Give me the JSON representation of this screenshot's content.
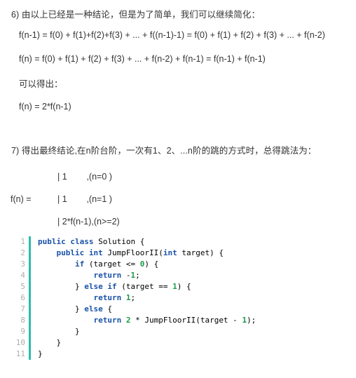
{
  "document": {
    "sections": [
      {
        "heading": "6) 由以上已经是一种结论，但是为了简单，我们可以继续简化：",
        "formulas": [
          "f(n-1) = f(0) + f(1)+f(2)+f(3) + ... + f((n-1)-1) = f(0) + f(1) + f(2) + f(3) + ... + f(n-2)",
          "f(n) = f(0) + f(1) + f(2) + f(3) + ... + f(n-2) + f(n-1) = f(n-1) + f(n-1)"
        ],
        "conclusion_label": "可以得出：",
        "conclusion_formula": "f(n) = 2*f(n-1)"
      },
      {
        "heading": "7) 得出最终结论,在n阶台阶，一次有1、2、...n阶的跳的方式时，总得跳法为：",
        "piecewise": {
          "lhs": "f(n) =",
          "rows": [
            "| 1        ,(n=0 )",
            "| 1        ,(n=1 )",
            "| 2*f(n-1),(n>=2)"
          ]
        }
      }
    ]
  },
  "code_block": {
    "language": "java",
    "gutter_accent_color": "#2bbbad",
    "keyword_color": "#1a52a8",
    "number_color": "#1a9a4a",
    "line_number_color": "#afafaf",
    "line_numbers": [
      "1",
      "2",
      "3",
      "4",
      "5",
      "6",
      "7",
      "8",
      "9",
      "10",
      "11"
    ],
    "lines": [
      [
        {
          "t": "kw",
          "s": "public"
        },
        {
          "t": "pn",
          "s": " "
        },
        {
          "t": "kw",
          "s": "class"
        },
        {
          "t": "pn",
          "s": " "
        },
        {
          "t": "id",
          "s": "Solution {"
        }
      ],
      [
        {
          "t": "pn",
          "s": "    "
        },
        {
          "t": "kw",
          "s": "public"
        },
        {
          "t": "pn",
          "s": " "
        },
        {
          "t": "kw",
          "s": "int"
        },
        {
          "t": "pn",
          "s": " "
        },
        {
          "t": "id",
          "s": "JumpFloorII("
        },
        {
          "t": "kw",
          "s": "int"
        },
        {
          "t": "id",
          "s": " target) {"
        }
      ],
      [
        {
          "t": "pn",
          "s": "        "
        },
        {
          "t": "kw",
          "s": "if"
        },
        {
          "t": "id",
          "s": " (target <= "
        },
        {
          "t": "num",
          "s": "0"
        },
        {
          "t": "id",
          "s": ") {"
        }
      ],
      [
        {
          "t": "pn",
          "s": "            "
        },
        {
          "t": "kw",
          "s": "return"
        },
        {
          "t": "id",
          "s": " -"
        },
        {
          "t": "num",
          "s": "1"
        },
        {
          "t": "id",
          "s": ";"
        }
      ],
      [
        {
          "t": "pn",
          "s": "        "
        },
        {
          "t": "id",
          "s": "} "
        },
        {
          "t": "kw",
          "s": "else"
        },
        {
          "t": "pn",
          "s": " "
        },
        {
          "t": "kw",
          "s": "if"
        },
        {
          "t": "id",
          "s": " (target == "
        },
        {
          "t": "num",
          "s": "1"
        },
        {
          "t": "id",
          "s": ") {"
        }
      ],
      [
        {
          "t": "pn",
          "s": "            "
        },
        {
          "t": "kw",
          "s": "return"
        },
        {
          "t": "id",
          "s": " "
        },
        {
          "t": "num",
          "s": "1"
        },
        {
          "t": "id",
          "s": ";"
        }
      ],
      [
        {
          "t": "pn",
          "s": "        "
        },
        {
          "t": "id",
          "s": "} "
        },
        {
          "t": "kw",
          "s": "else"
        },
        {
          "t": "id",
          "s": " {"
        }
      ],
      [
        {
          "t": "pn",
          "s": "            "
        },
        {
          "t": "kw",
          "s": "return"
        },
        {
          "t": "id",
          "s": " "
        },
        {
          "t": "num",
          "s": "2"
        },
        {
          "t": "id",
          "s": " * JumpFloorII(target - "
        },
        {
          "t": "num",
          "s": "1"
        },
        {
          "t": "id",
          "s": ");"
        }
      ],
      [
        {
          "t": "pn",
          "s": "        "
        },
        {
          "t": "id",
          "s": "}"
        }
      ],
      [
        {
          "t": "pn",
          "s": "    "
        },
        {
          "t": "id",
          "s": "}"
        }
      ],
      [
        {
          "t": "id",
          "s": "}"
        }
      ]
    ]
  }
}
